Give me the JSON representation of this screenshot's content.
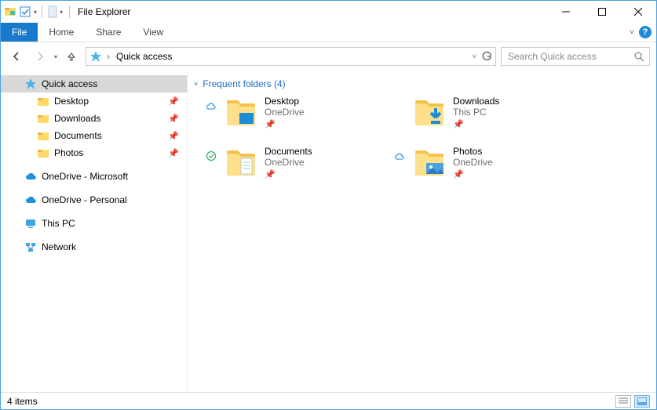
{
  "titlebar": {
    "title": "File Explorer"
  },
  "ribbon": {
    "file": "File",
    "tabs": [
      "Home",
      "Share",
      "View"
    ]
  },
  "nav": {
    "breadcrumb_root": "Quick access",
    "search_placeholder": "Search Quick access"
  },
  "sidebar": {
    "items": [
      {
        "label": "Quick access",
        "icon": "star",
        "selected": true,
        "expandable": true
      },
      {
        "label": "Desktop",
        "icon": "folder",
        "child": true,
        "pinned": true
      },
      {
        "label": "Downloads",
        "icon": "folder",
        "child": true,
        "pinned": true
      },
      {
        "label": "Documents",
        "icon": "folder",
        "child": true,
        "pinned": true
      },
      {
        "label": "Photos",
        "icon": "folder",
        "child": true,
        "pinned": true
      },
      {
        "label": "OneDrive - Microsoft",
        "icon": "cloud",
        "expandable": true
      },
      {
        "label": "OneDrive - Personal",
        "icon": "cloud",
        "expandable": true
      },
      {
        "label": "This PC",
        "icon": "pc",
        "expandable": true
      },
      {
        "label": "Network",
        "icon": "network",
        "expandable": true
      }
    ]
  },
  "main": {
    "group_header": "Frequent folders (4)",
    "tiles": [
      {
        "name": "Desktop",
        "location": "OneDrive",
        "badge": "cloud",
        "icon": "folder-desktop"
      },
      {
        "name": "Downloads",
        "location": "This PC",
        "badge": "",
        "icon": "folder-download"
      },
      {
        "name": "Documents",
        "location": "OneDrive",
        "badge": "check",
        "icon": "folder-doc"
      },
      {
        "name": "Photos",
        "location": "OneDrive",
        "badge": "cloud",
        "icon": "folder-photo"
      }
    ]
  },
  "statusbar": {
    "text": "4 items"
  }
}
